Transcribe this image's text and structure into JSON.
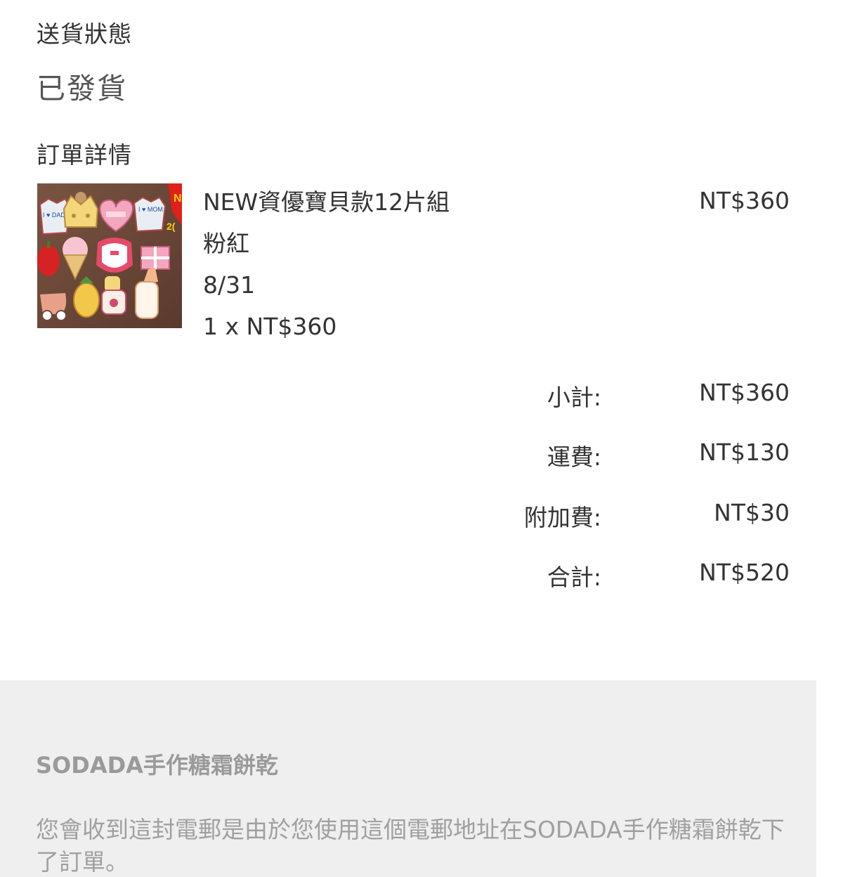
{
  "delivery": {
    "heading": "送貨狀態",
    "status": "已發貨"
  },
  "order": {
    "heading": "訂單詳情",
    "item": {
      "name": "NEW資優寶貝款12片組",
      "variant": "粉紅",
      "date": "8/31",
      "quantity_price": "1 x NT$360",
      "price": "NT$360"
    }
  },
  "summary": {
    "subtotal_label": "小計:",
    "subtotal_value": "NT$360",
    "shipping_label": "運費:",
    "shipping_value": "NT$130",
    "extra_label": "附加費:",
    "extra_value": "NT$30",
    "total_label": "合計:",
    "total_value": "NT$520"
  },
  "footer": {
    "shop_name": "SODADA手作糖霜餅乾",
    "note": "您會收到這封電郵是由於您使用這個電郵地址在SODADA手作糖霜餅乾下了訂單。"
  },
  "thumbnail_text": {
    "dad_tag": "I ♥ DAD",
    "mom_tag": "I ♥ MOM",
    "corner_badge": "N",
    "corner_number": "2("
  }
}
